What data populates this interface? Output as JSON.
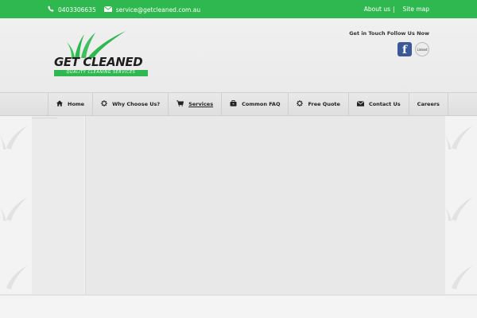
{
  "topbar": {
    "phone": "0403306635",
    "email": "service@getcleaned.com.au",
    "links": [
      "About us",
      "Site map"
    ],
    "separator": "|"
  },
  "logo": {
    "brand": "GET CLEANED",
    "tagline": "QUALITY CLEANING SERVICES"
  },
  "social": {
    "title": "Get in Touch Follow Us Now",
    "facebook_glyph": "f",
    "linkedin_glyph": "Linked"
  },
  "nav": {
    "items": [
      {
        "label": "Home",
        "icon": "home-icon"
      },
      {
        "label": "Why Choose Us?",
        "icon": "gear-icon"
      },
      {
        "label": "Services",
        "icon": "cart-icon"
      },
      {
        "label": "Common FAQ",
        "icon": "briefcase-icon"
      },
      {
        "label": "Free Quote",
        "icon": "gear-icon"
      },
      {
        "label": "Contact Us",
        "icon": "envelope-icon"
      },
      {
        "label": "Careers",
        "icon": ""
      }
    ],
    "active_index": 2
  },
  "colors": {
    "brand_green": "#2fb84f",
    "facebook_blue": "#3b5998"
  }
}
